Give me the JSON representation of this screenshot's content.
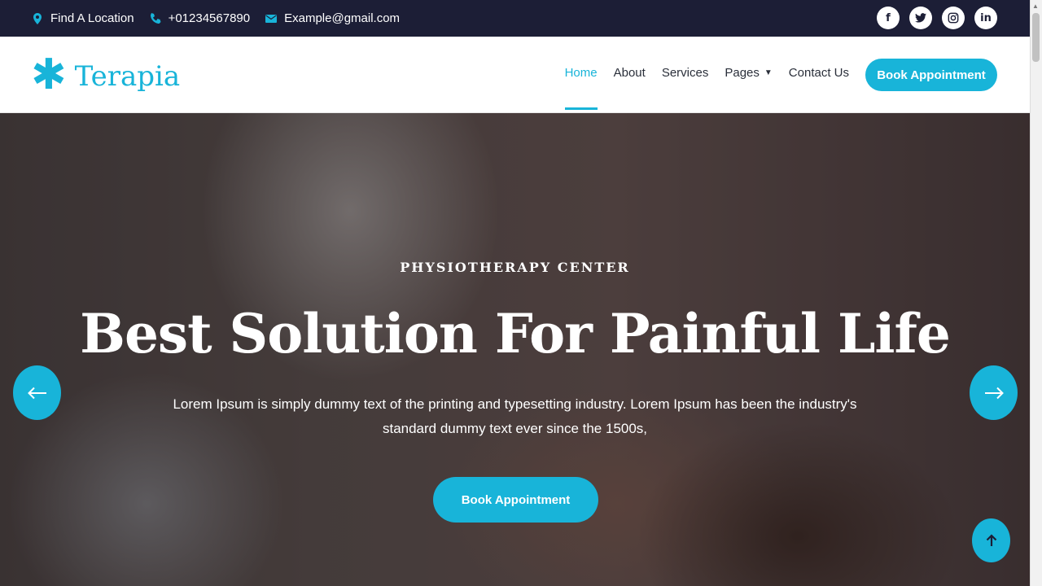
{
  "topbar": {
    "location": "Find A Location",
    "phone": "+01234567890",
    "email": "Example@gmail.com",
    "social": [
      "f",
      "t",
      "ig",
      "in"
    ]
  },
  "brand": {
    "name": "Terapia",
    "color": "#18b4d9"
  },
  "nav": {
    "items": [
      {
        "label": "Home",
        "active": true
      },
      {
        "label": "About"
      },
      {
        "label": "Services"
      },
      {
        "label": "Pages",
        "dropdown": true
      },
      {
        "label": "Contact Us"
      }
    ],
    "cta": "Book Appointment"
  },
  "hero": {
    "kicker": "PHYSIOTHERAPY CENTER",
    "headline": "Best Solution For Painful Life",
    "description": "Lorem Ipsum is simply dummy text of the printing and typesetting industry. Lorem Ipsum has been the industry's standard dummy text ever since the 1500s,",
    "cta": "Book Appointment"
  },
  "icons": {
    "location": "map-pin-icon",
    "phone": "phone-icon",
    "email": "envelope-icon",
    "prev": "arrow-left-icon",
    "next": "arrow-right-icon",
    "top": "arrow-up-icon"
  }
}
